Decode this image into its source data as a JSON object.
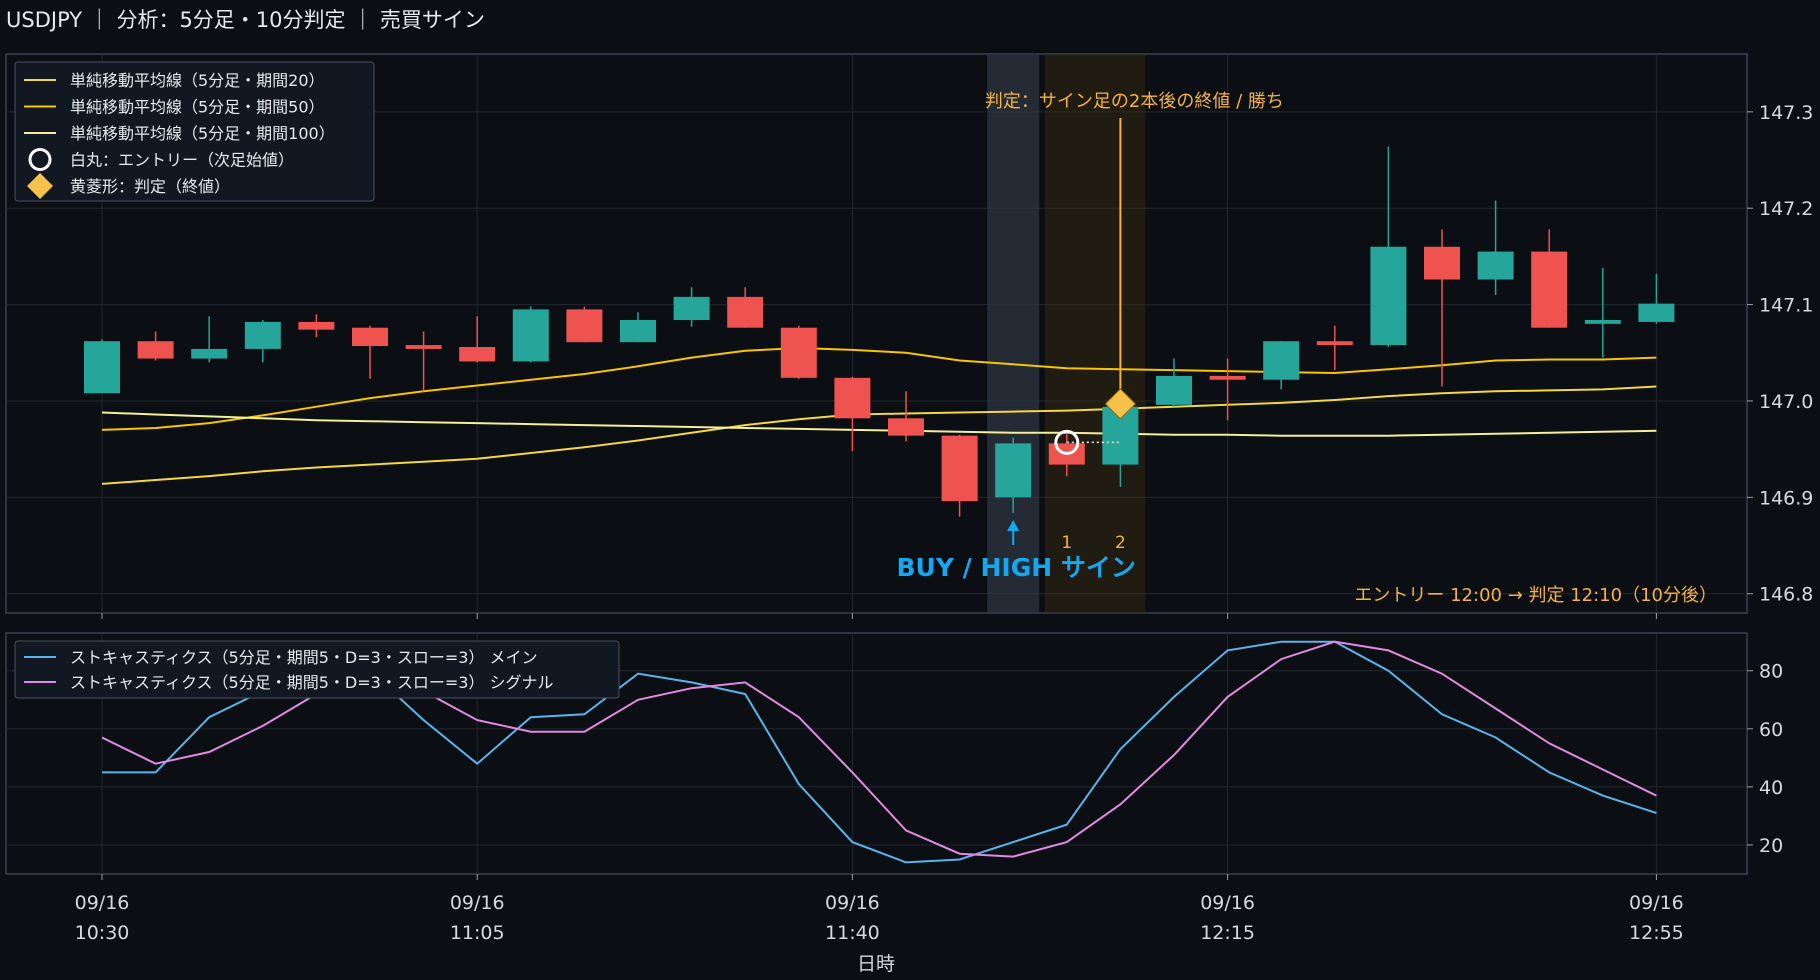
{
  "title": "USDJPY ｜ 分析：5分足・10分判定 ｜ 売買サイン",
  "colors": {
    "background": "#0b0e13",
    "up": "#26a69a",
    "down": "#ef5350",
    "sma20": "#f5d742",
    "sma50": "#f7c600",
    "sma100": "#f3ef9a",
    "stoch_main": "#5ab4ea",
    "stoch_signal": "#e18be0",
    "signal_blue": "#13a8f0",
    "judge_orange": "#f5b342",
    "grid": "#222832"
  },
  "chart_data": [
    {
      "type": "candlestick",
      "title": "",
      "xlabel": "日時",
      "ylabel": "",
      "ylim": [
        146.78,
        147.36
      ],
      "yticks": [
        146.8,
        146.9,
        147.0,
        147.1,
        147.2,
        147.3
      ],
      "x_tick_labels": [
        {
          "index": 0,
          "date": "09/16",
          "time": "10:30"
        },
        {
          "index": 7,
          "date": "09/16",
          "time": "11:05"
        },
        {
          "index": 14,
          "date": "09/16",
          "time": "11:40"
        },
        {
          "index": 21,
          "date": "09/16",
          "time": "12:15"
        },
        {
          "index": 29,
          "date": "09/16",
          "time": "12:55"
        }
      ],
      "candles": [
        {
          "o": 147.008,
          "h": 147.064,
          "l": 147.008,
          "c": 147.062
        },
        {
          "o": 147.062,
          "h": 147.072,
          "l": 147.042,
          "c": 147.044
        },
        {
          "o": 147.044,
          "h": 147.088,
          "l": 147.04,
          "c": 147.054
        },
        {
          "o": 147.054,
          "h": 147.084,
          "l": 147.04,
          "c": 147.082
        },
        {
          "o": 147.082,
          "h": 147.09,
          "l": 147.066,
          "c": 147.074
        },
        {
          "o": 147.076,
          "h": 147.078,
          "l": 147.023,
          "c": 147.057
        },
        {
          "o": 147.058,
          "h": 147.072,
          "l": 147.01,
          "c": 147.054
        },
        {
          "o": 147.056,
          "h": 147.088,
          "l": 147.04,
          "c": 147.041
        },
        {
          "o": 147.041,
          "h": 147.098,
          "l": 147.04,
          "c": 147.095
        },
        {
          "o": 147.095,
          "h": 147.098,
          "l": 147.061,
          "c": 147.061
        },
        {
          "o": 147.061,
          "h": 147.092,
          "l": 147.061,
          "c": 147.084
        },
        {
          "o": 147.084,
          "h": 147.118,
          "l": 147.077,
          "c": 147.108
        },
        {
          "o": 147.108,
          "h": 147.118,
          "l": 147.076,
          "c": 147.076
        },
        {
          "o": 147.076,
          "h": 147.078,
          "l": 147.023,
          "c": 147.024
        },
        {
          "o": 147.024,
          "h": 147.025,
          "l": 146.948,
          "c": 146.982
        },
        {
          "o": 146.982,
          "h": 147.01,
          "l": 146.958,
          "c": 146.964
        },
        {
          "o": 146.964,
          "h": 146.965,
          "l": 146.88,
          "c": 146.896
        },
        {
          "o": 146.9,
          "h": 146.962,
          "l": 146.884,
          "c": 146.956
        },
        {
          "o": 146.956,
          "h": 146.97,
          "l": 146.922,
          "c": 146.934
        },
        {
          "o": 146.934,
          "h": 146.998,
          "l": 146.911,
          "c": 146.994
        },
        {
          "o": 146.996,
          "h": 147.044,
          "l": 146.994,
          "c": 147.026
        },
        {
          "o": 147.026,
          "h": 147.044,
          "l": 146.98,
          "c": 147.022
        },
        {
          "o": 147.022,
          "h": 147.062,
          "l": 147.012,
          "c": 147.062
        },
        {
          "o": 147.062,
          "h": 147.078,
          "l": 147.032,
          "c": 147.058
        },
        {
          "o": 147.058,
          "h": 147.264,
          "l": 147.056,
          "c": 147.16
        },
        {
          "o": 147.16,
          "h": 147.178,
          "l": 147.015,
          "c": 147.126
        },
        {
          "o": 147.126,
          "h": 147.208,
          "l": 147.11,
          "c": 147.155
        },
        {
          "o": 147.155,
          "h": 147.178,
          "l": 147.076,
          "c": 147.076
        },
        {
          "o": 147.08,
          "h": 147.138,
          "l": 147.045,
          "c": 147.084
        },
        {
          "o": 147.082,
          "h": 147.132,
          "l": 147.08,
          "c": 147.101
        }
      ],
      "series": [
        {
          "name": "単純移動平均線（5分足・期間20）",
          "color_key": "sma20",
          "values": [
            146.914,
            146.918,
            146.922,
            146.927,
            146.931,
            146.934,
            146.937,
            146.94,
            146.946,
            146.952,
            146.959,
            146.967,
            146.975,
            146.981,
            146.986,
            146.987,
            146.988,
            146.989,
            146.99,
            146.992,
            146.994,
            146.996,
            146.998,
            147.001,
            147.005,
            147.008,
            147.01,
            147.011,
            147.012,
            147.015
          ]
        },
        {
          "name": "単純移動平均線（5分足・期間50）",
          "color_key": "sma50",
          "values": [
            146.97,
            146.972,
            146.977,
            146.985,
            146.994,
            147.003,
            147.01,
            147.016,
            147.022,
            147.028,
            147.036,
            147.045,
            147.052,
            147.055,
            147.053,
            147.05,
            147.042,
            147.038,
            147.034,
            147.033,
            147.032,
            147.031,
            147.03,
            147.029,
            147.033,
            147.037,
            147.042,
            147.043,
            147.043,
            147.045
          ]
        },
        {
          "name": "単純移動平均線（5分足・期間100）",
          "color_key": "sma100",
          "values": [
            146.988,
            146.986,
            146.984,
            146.982,
            146.98,
            146.979,
            146.978,
            146.977,
            146.976,
            146.975,
            146.974,
            146.973,
            146.972,
            146.971,
            146.97,
            146.969,
            146.968,
            146.967,
            146.967,
            146.966,
            146.965,
            146.965,
            146.964,
            146.964,
            146.964,
            146.965,
            146.966,
            146.967,
            146.968,
            146.969
          ]
        }
      ],
      "legend": [
        {
          "label": "単純移動平均線（5分足・期間20）",
          "marker": "line",
          "color_key": "sma20"
        },
        {
          "label": "単純移動平均線（5分足・期間50）",
          "marker": "line",
          "color_key": "sma50"
        },
        {
          "label": "単純移動平均線（5分足・期間100）",
          "marker": "line",
          "color_key": "sma100"
        },
        {
          "label": "白丸：エントリー（次足始値）",
          "marker": "circle"
        },
        {
          "label": "黄菱形：判定（終値）",
          "marker": "diamond"
        }
      ],
      "legend_position": "top-left",
      "signal": {
        "index": 17,
        "label": "BUY / HIGH サイン",
        "entry": {
          "index": 18,
          "price": 146.957
        },
        "judge": {
          "index": 19,
          "price": 146.997
        },
        "count_labels": [
          {
            "index": 18,
            "text": "1"
          },
          {
            "index": 19,
            "text": "2"
          }
        ],
        "judge_label": "判定：サイン足の2本後の終値 / 勝ち",
        "summary": "エントリー 12:00 → 判定 12:10（10分後）"
      }
    },
    {
      "type": "line",
      "title": "",
      "ylim": [
        10,
        93
      ],
      "yticks": [
        20,
        40,
        60,
        80
      ],
      "legend_position": "top-left",
      "series": [
        {
          "name": "ストキャスティクス（5分足・期間5・D=3・スロー=3） メイン",
          "color_key": "stoch_main",
          "values": [
            45,
            45,
            64,
            73,
            78,
            80,
            63,
            48,
            64,
            65,
            79,
            76,
            72,
            41,
            21,
            14,
            15,
            21,
            27,
            53,
            71,
            87,
            90,
            90,
            80,
            65,
            57,
            45,
            37,
            31
          ]
        },
        {
          "name": "ストキャスティクス（5分足・期間5・D=3・スロー=3） シグナル",
          "color_key": "stoch_signal",
          "values": [
            57,
            48,
            52,
            61,
            72,
            78,
            73,
            63,
            59,
            59,
            70,
            74,
            76,
            64,
            45,
            25,
            17,
            16,
            21,
            34,
            51,
            71,
            84,
            90,
            87,
            79,
            67,
            55,
            46,
            37
          ]
        }
      ]
    }
  ]
}
